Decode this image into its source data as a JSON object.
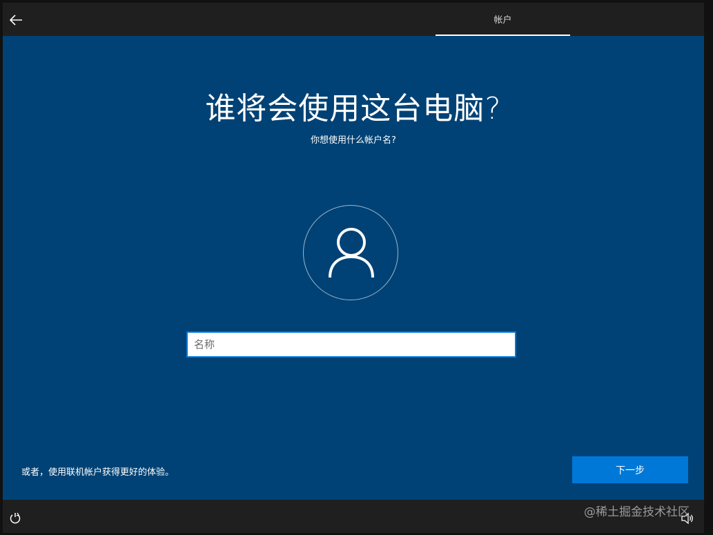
{
  "header": {
    "tab_label": "帐户"
  },
  "main": {
    "title": "谁将会使用这台电脑?",
    "subtitle": "你想使用什么帐户名?",
    "name_input": {
      "placeholder": "名称",
      "value": ""
    },
    "online_account_link": "或者，使用联机帐户获得更好的体验。",
    "next_button": "下一步"
  },
  "footer": {
    "watermark": "@稀土掘金技术社区"
  },
  "icons": {
    "back": "back-arrow-icon",
    "avatar": "user-icon",
    "ease_of_access": "ease-of-access-icon",
    "volume": "volume-icon"
  },
  "colors": {
    "background": "#004275",
    "accent": "#0078d7",
    "bar": "#1f1f1f"
  }
}
